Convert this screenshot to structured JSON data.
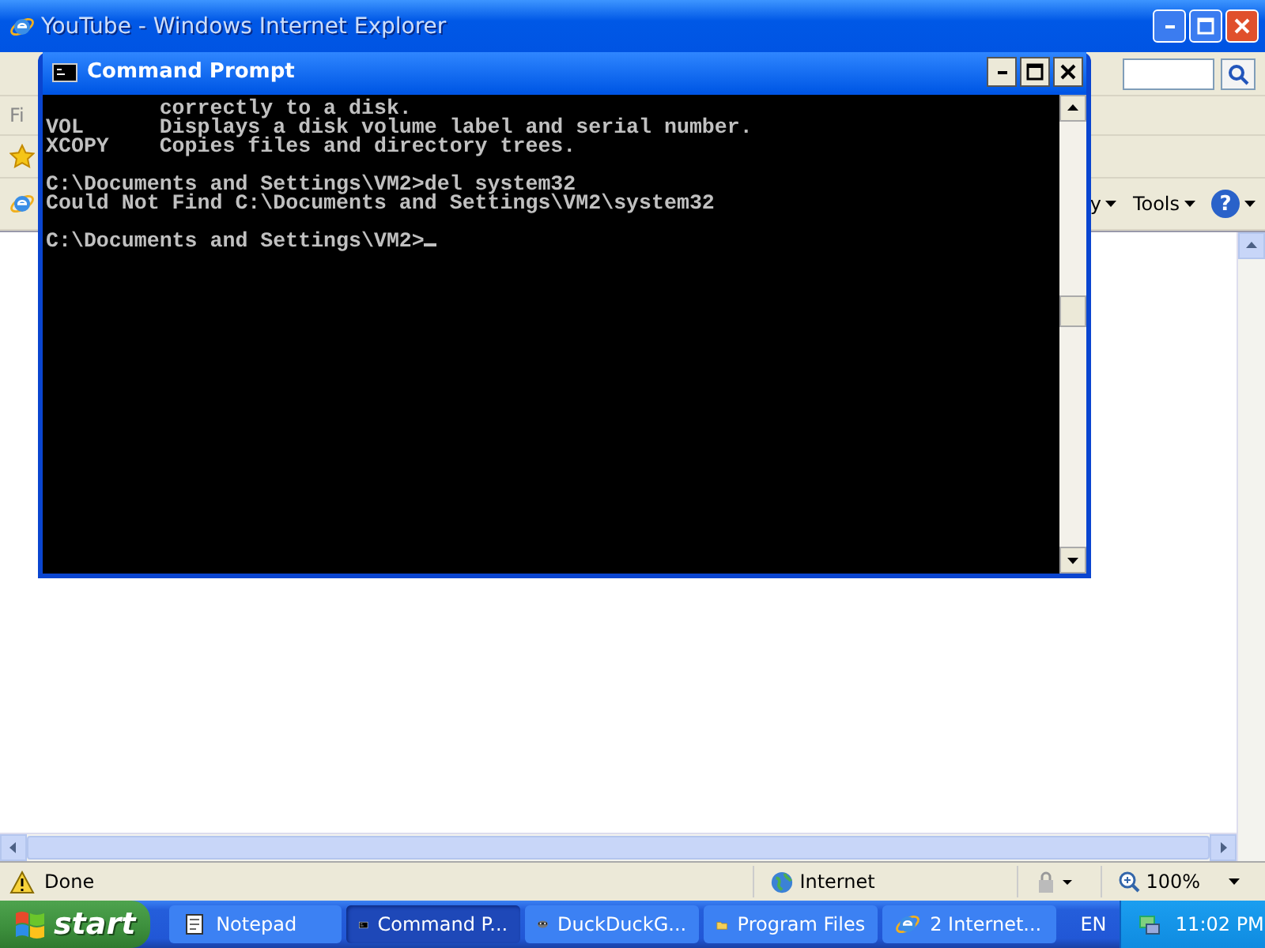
{
  "browser": {
    "title": "YouTube - Windows Internet Explorer",
    "menu_fragment": "Fi",
    "toolbar": [
      {
        "label": "y"
      },
      {
        "label": "Tools"
      }
    ],
    "help": "?",
    "status_bar": {
      "text": "Done",
      "zone": "Internet",
      "zoom": "100%"
    }
  },
  "console": {
    "title": "Command Prompt",
    "blocks": [
      [
        "         correctly to a disk.",
        "VOL      Displays a disk volume label and serial number.",
        "XCOPY    Copies files and directory trees."
      ],
      [
        "C:\\Documents and Settings\\VM2>del system32",
        "Could Not Find C:\\Documents and Settings\\VM2\\system32"
      ],
      [
        "C:\\Documents and Settings\\VM2>"
      ]
    ]
  },
  "taskbar": {
    "start": "start",
    "buttons": [
      {
        "label": "Notepad",
        "kind": "notepad",
        "selected": false
      },
      {
        "label": "Command P...",
        "kind": "console",
        "selected": true
      },
      {
        "label": "DuckDuckG...",
        "kind": "duck",
        "selected": false
      },
      {
        "label": "Program Files",
        "kind": "folder",
        "selected": false
      },
      {
        "label": "2 Internet...",
        "kind": "browser",
        "selected": false
      }
    ],
    "language": "EN",
    "clock": "11:02 PM"
  }
}
